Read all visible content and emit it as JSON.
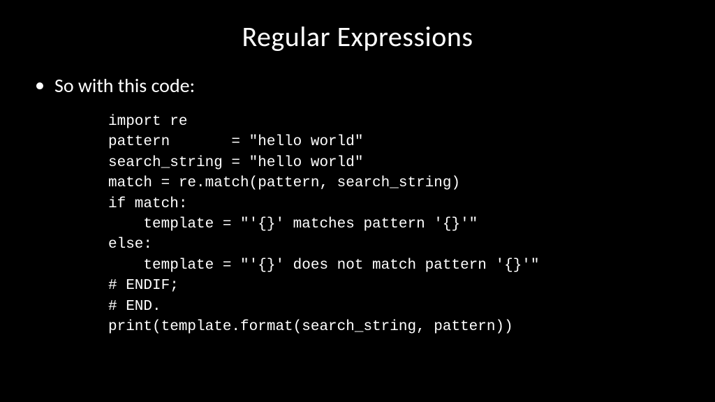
{
  "title": "Regular Expressions",
  "bullet": "So with this code:",
  "code": "import re\npattern       = \"hello world\"\nsearch_string = \"hello world\"\nmatch = re.match(pattern, search_string)\nif match:\n    template = \"'{}' matches pattern '{}'\"\nelse:\n    template = \"'{}' does not match pattern '{}'\"\n# ENDIF;\n# END.\nprint(template.format(search_string, pattern))"
}
